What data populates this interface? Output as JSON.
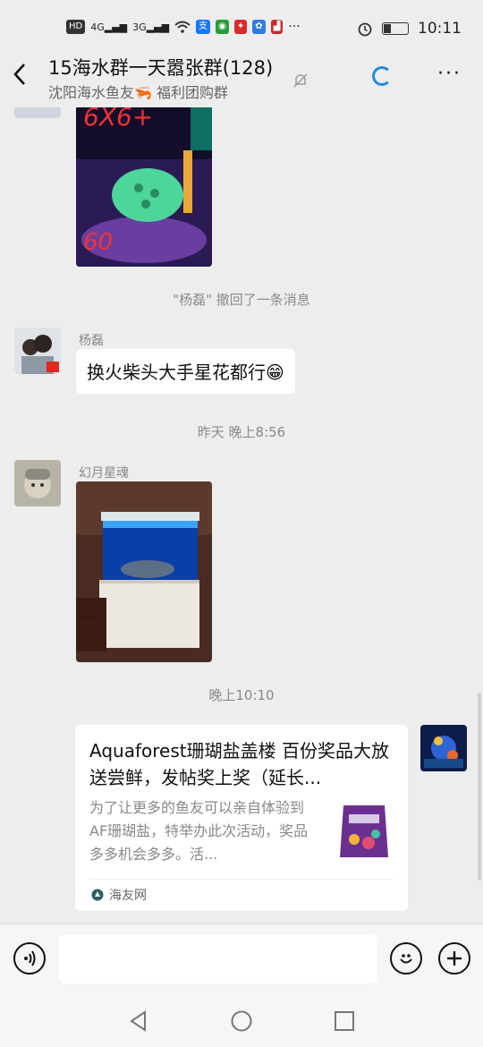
{
  "status_bar": {
    "left_chips": [
      "HD",
      "4G",
      "3G"
    ],
    "time": "10:11",
    "battery_level": 0.3,
    "more_label": "···"
  },
  "header": {
    "title": "15海水群一天嚣张群(128)",
    "subtitle": "沈阳海水鱼友🦐 福利团购群",
    "more_label": "···",
    "back_label": "‹"
  },
  "messages": {
    "image1_text": "6X6+",
    "image1_text2": "60",
    "recall_notice": "\"杨磊\" 撤回了一条消息",
    "msg2_sender": "杨磊",
    "msg2_text": "换火柴头大手星花都行😁",
    "timestamp1": "昨天 晚上8:56",
    "msg3_sender": "幻月星魂",
    "timestamp2": "晚上10:10"
  },
  "card": {
    "title": "Aquaforest珊瑚盐盖楼 百份奖品大放送尝鲜，发帖奖上奖（延长...",
    "description": "为了让更多的鱼友可以亲自体验到AF珊瑚盐，特举办此次活动，奖品多多机会多多。活...",
    "source": "海友网"
  },
  "colors": {
    "accent": "#1f8fd9",
    "background": "#ededed",
    "bubble": "#ffffff"
  }
}
